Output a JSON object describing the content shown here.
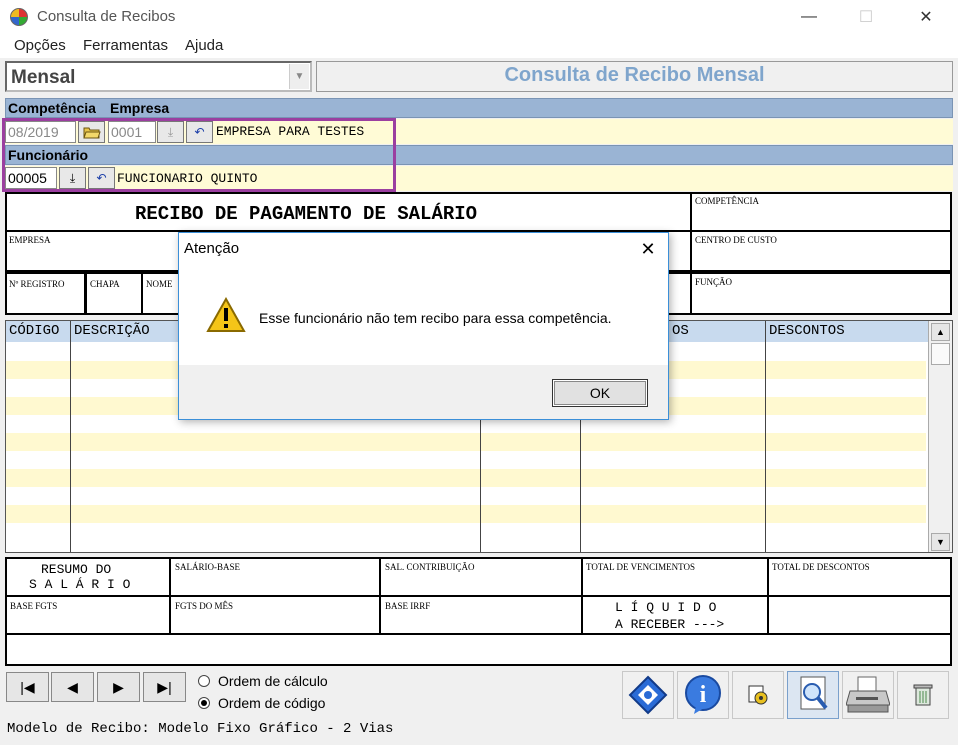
{
  "window": {
    "title": "Consulta de Recibos",
    "minimize": "—",
    "maximize": "☐",
    "close": "✕"
  },
  "menu": [
    "Opções",
    "Ferramentas",
    "Ajuda"
  ],
  "mode": {
    "selected": "Mensal"
  },
  "header_title": "Consulta de Recibo Mensal",
  "labels": {
    "competencia": "Competência",
    "empresa": "Empresa",
    "funcionario": "Funcionário"
  },
  "fields": {
    "competencia": "08/2019",
    "empresa_code": "0001",
    "empresa_name": "EMPRESA PARA TESTES",
    "funcionario_code": "00005",
    "funcionario_name": "FUNCIONARIO QUINTO"
  },
  "receipt": {
    "title": "RECIBO DE PAGAMENTO DE SALÁRIO",
    "competencia": "COMPETÊNCIA",
    "empresa": "EMPRESA",
    "centro_custo": "CENTRO DE CUSTO",
    "registro": "Nº REGISTRO",
    "chapa": "CHAPA",
    "nome": "NOME",
    "funcao": "FUNÇÃO"
  },
  "table": {
    "codigo": "CÓDIGO",
    "descricao": "DESCRIÇÃO",
    "vencimentos": "OS",
    "descontos": "DESCONTOS"
  },
  "summary": {
    "resumo1": "RESUMO DO",
    "resumo2": "S A L Á R I O",
    "salario_base": "SALÁRIO-BASE",
    "sal_contribuicao": "SAL. CONTRIBUIÇÃO",
    "total_vencimentos": "TOTAL DE VENCIMENTOS",
    "total_descontos": "TOTAL DE DESCONTOS",
    "base_fgts": "BASE FGTS",
    "fgts_mes": "FGTS DO MÊS",
    "base_irrf": "BASE IRRF",
    "liquido1": "L Í Q U I D O",
    "liquido2": "A RECEBER --->"
  },
  "dialog": {
    "title": "Atenção",
    "message": "Esse funcionário não tem recibo para essa competência.",
    "ok": "OK"
  },
  "order": {
    "calc": "Ordem de cálculo",
    "code": "Ordem de código",
    "selected": "code"
  },
  "status": "Modelo de Recibo: Modelo Fixo Gráfico - 2 Vias",
  "colors": {
    "accent": "#9ab4d4",
    "highlight": "#9b3fa0",
    "title_blue": "#7fa5cc"
  }
}
